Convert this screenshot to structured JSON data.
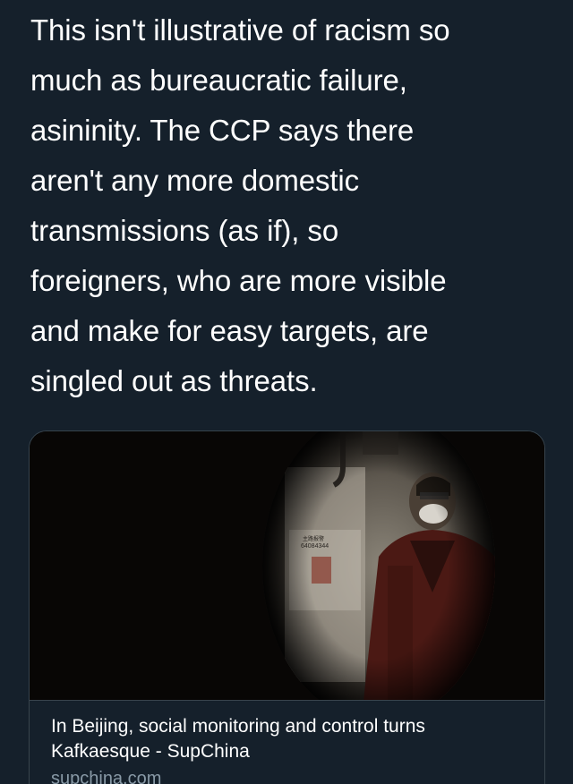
{
  "tweet": {
    "text_lines": [
      "This isn't illustrative of racism so",
      "much as bureaucratic failure,",
      "asininity. The CCP says there",
      "aren't any more domestic",
      "transmissions (as if), so",
      "foreigners, who are more visible",
      "and make for easy targets, are",
      "singled out as threats."
    ]
  },
  "card": {
    "title_lines": [
      "In Beijing, social monitoring and control turns",
      "Kafkaesque - SupChina"
    ],
    "domain": "supchina.com",
    "image_sign_lines": [
      "主路报警",
      "64084344"
    ]
  }
}
